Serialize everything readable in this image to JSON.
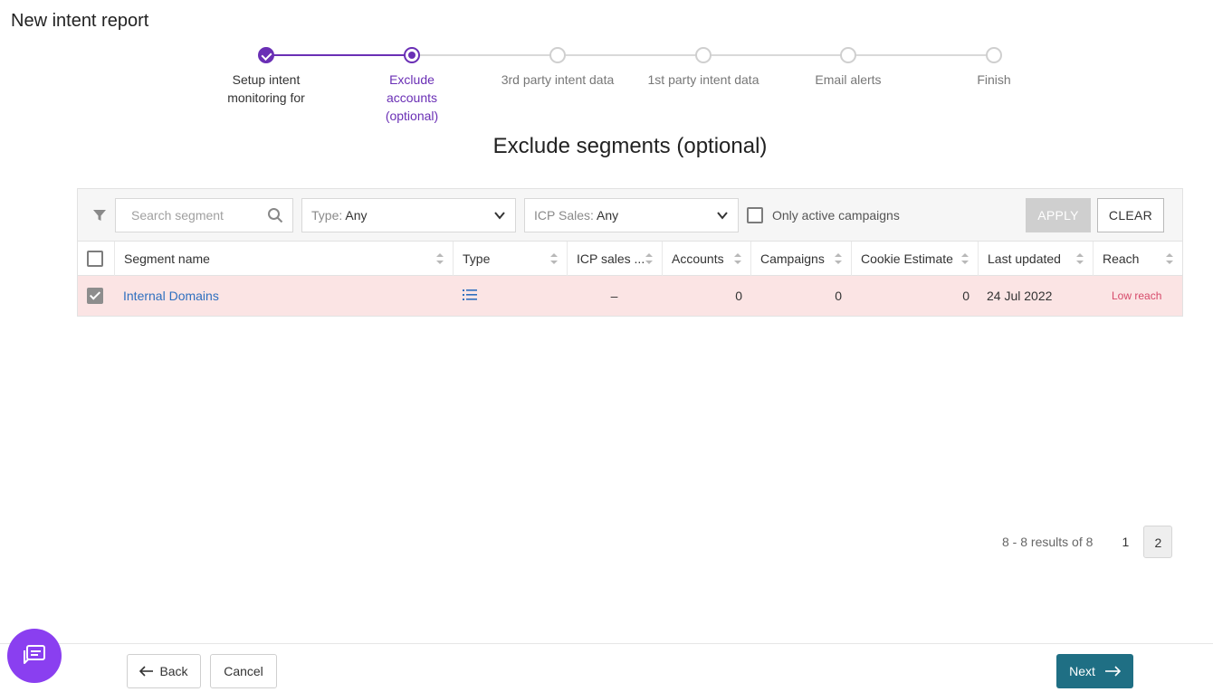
{
  "header": {
    "title": "New intent report"
  },
  "stepper": {
    "steps": [
      {
        "label": "Setup intent monitoring for",
        "state": "done"
      },
      {
        "label": "Exclude accounts (optional)",
        "state": "active"
      },
      {
        "label": "3rd party intent data",
        "state": "pending"
      },
      {
        "label": "1st party intent data",
        "state": "pending"
      },
      {
        "label": "Email alerts",
        "state": "pending"
      },
      {
        "label": "Finish",
        "state": "pending"
      }
    ]
  },
  "section": {
    "title": "Exclude segments (optional)"
  },
  "filters": {
    "search_placeholder": "Search segment",
    "type_prefix": "Type:",
    "type_value": "Any",
    "icp_prefix": "ICP Sales:",
    "icp_value": "Any",
    "only_active_label": "Only active campaigns",
    "apply_label": "APPLY",
    "clear_label": "CLEAR"
  },
  "table": {
    "columns": [
      "Segment name",
      "Type",
      "ICP sales ...",
      "Accounts",
      "Campaigns",
      "Cookie Estimate",
      "Last updated",
      "Reach"
    ],
    "rows": [
      {
        "segment_name": "Internal Domains",
        "type_icon": "list-icon",
        "icp_sales": "–",
        "accounts": "0",
        "campaigns": "0",
        "cookie_estimate": "0",
        "last_updated": "24 Jul 2022",
        "reach": "Low reach",
        "checked": true
      }
    ]
  },
  "pagination": {
    "results": "8 - 8 results of 8",
    "pages": [
      "1",
      "2"
    ],
    "current": "2"
  },
  "footer": {
    "back_label": "Back",
    "cancel_label": "Cancel",
    "next_label": "Next"
  },
  "colors": {
    "accent": "#6a2fb5",
    "primary_button": "#1f6f84",
    "row_highlight": "#fbe4e4",
    "low_reach": "#d64a6a",
    "chat_fab": "#8a3ff0"
  }
}
